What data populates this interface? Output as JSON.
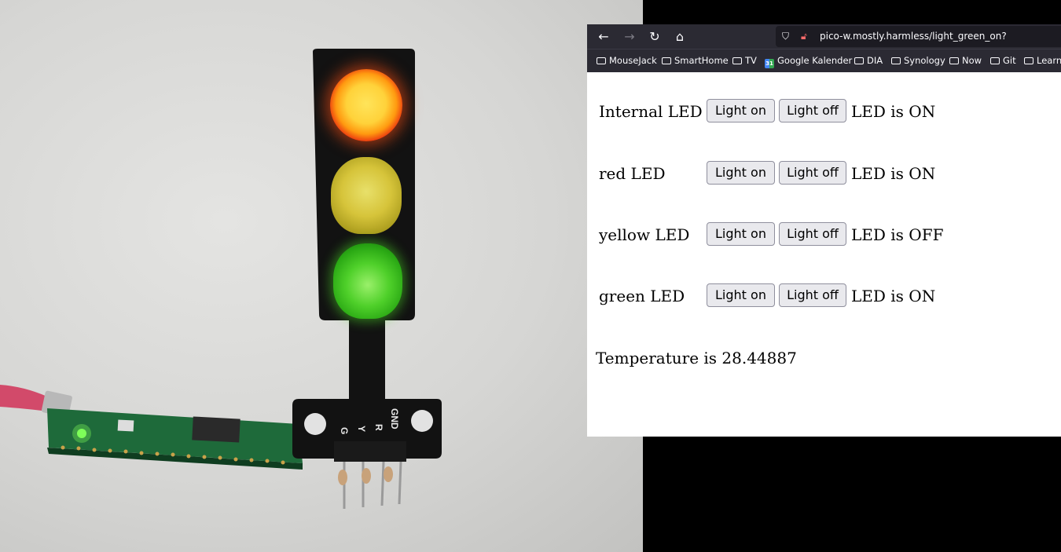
{
  "browser": {
    "url": "pico-w.mostly.harmless/light_green_on?",
    "bookmarks": [
      "MouseJack",
      "SmartHome",
      "TV",
      "Google Kalender",
      "DIA",
      "Synology",
      "Now",
      "Git",
      "Learn"
    ]
  },
  "controls": [
    {
      "label": "Internal LED",
      "on": "Light on",
      "off": "Light off",
      "status": "LED is ON"
    },
    {
      "label": "red LED",
      "on": "Light on",
      "off": "Light off",
      "status": "LED is ON"
    },
    {
      "label": "yellow LED",
      "on": "Light on",
      "off": "Light off",
      "status": "LED is OFF"
    },
    {
      "label": "green LED",
      "on": "Light on",
      "off": "Light off",
      "status": "LED is ON"
    }
  ],
  "temperature": "Temperature is 28.44887",
  "board": {
    "pins": [
      "GND",
      "R",
      "Y",
      "G"
    ],
    "calendar_icon_text": "31"
  },
  "colors": {
    "toolbar": "#2b2a33",
    "urlbar": "#1c1b22",
    "button_bg": "#e9e9ed",
    "led_red": "#ff3a10",
    "led_green": "#4fd02a",
    "led_yellow_off": "#c9b63a"
  }
}
